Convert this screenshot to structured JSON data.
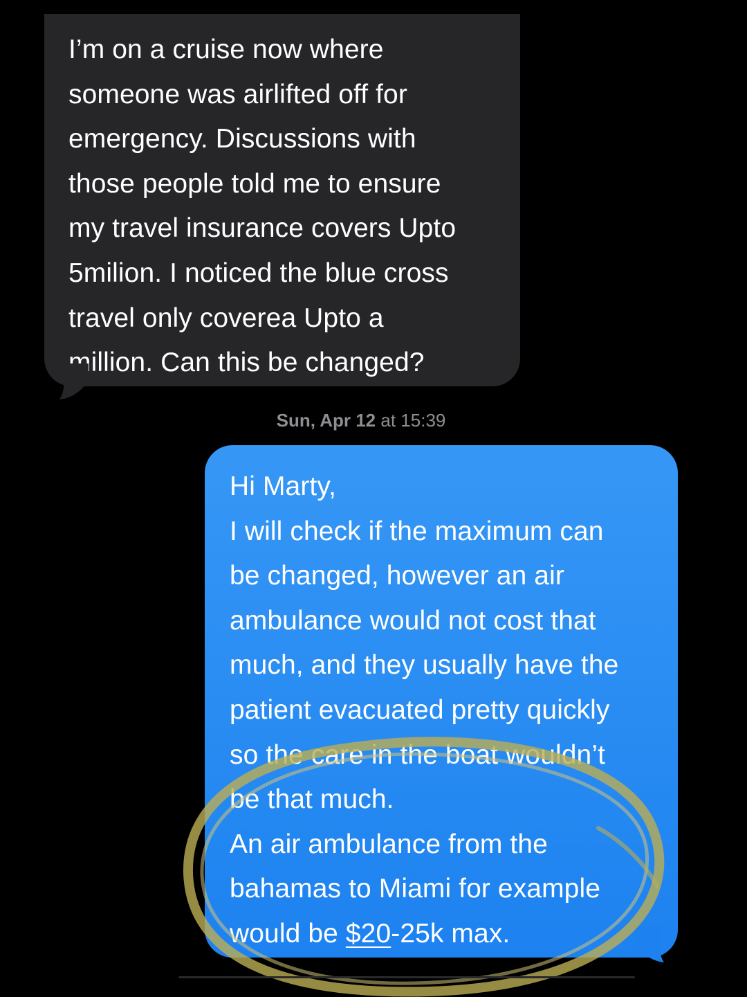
{
  "colors": {
    "background": "#000000",
    "incoming_bubble": "#262628",
    "outgoing_bubble": "#1f83f0",
    "timestamp_text": "#8e8e93",
    "annotation_ring": "#bcae54"
  },
  "incoming_message": {
    "lines": [
      "I’m on a cruise now where",
      "someone was airlifted off for",
      "emergency.  Discussions with",
      "those people told me to ensure",
      "my travel insurance covers Upto",
      "5milion.  I noticed the blue cross",
      "travel only coverea Upto a",
      "million.  Can this be changed?"
    ]
  },
  "timestamp": {
    "day": "Sun, Apr 12",
    "at": "at",
    "time": "15:39"
  },
  "outgoing_message": {
    "lines": [
      "Hi Marty,",
      "I will check if the maximum can",
      "be changed, however an air",
      "ambulance would not cost that",
      "much, and they usually have the",
      "patient evacuated pretty quickly",
      "so the care in the boat wouldn’t",
      "be that much.",
      "An air ambulance from the",
      "bahamas to Miami for example"
    ],
    "last_line_prefix": "would be ",
    "last_line_link": "$20",
    "last_line_suffix": "-25k max."
  }
}
